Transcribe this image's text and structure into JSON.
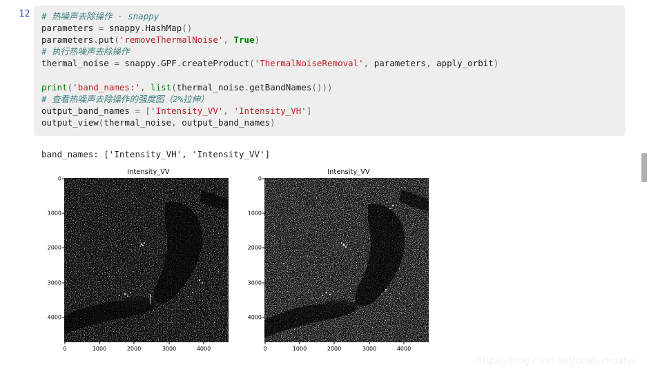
{
  "notebook": {
    "cell_prompt": "12",
    "code_lines": [
      [
        {
          "t": "cm",
          "v": "# 热噪声去除操作 - snappy"
        }
      ],
      [
        {
          "t": "nm",
          "v": "parameters "
        },
        {
          "t": "pn",
          "v": "= "
        },
        {
          "t": "nm",
          "v": "snappy"
        },
        {
          "t": "pn",
          "v": "."
        },
        {
          "t": "nm",
          "v": "HashMap"
        },
        {
          "t": "pn",
          "v": "()"
        }
      ],
      [
        {
          "t": "nm",
          "v": "parameters"
        },
        {
          "t": "pn",
          "v": "."
        },
        {
          "t": "nm",
          "v": "put"
        },
        {
          "t": "pn",
          "v": "("
        },
        {
          "t": "st",
          "v": "'removeThermalNoise'"
        },
        {
          "t": "pn",
          "v": ", "
        },
        {
          "t": "kw",
          "v": "True"
        },
        {
          "t": "pn",
          "v": ")"
        }
      ],
      [
        {
          "t": "cm",
          "v": "# 执行热噪声去除操作"
        }
      ],
      [
        {
          "t": "nm",
          "v": "thermal_noise "
        },
        {
          "t": "pn",
          "v": "= "
        },
        {
          "t": "nm",
          "v": "snappy"
        },
        {
          "t": "pn",
          "v": "."
        },
        {
          "t": "nm",
          "v": "GPF"
        },
        {
          "t": "pn",
          "v": "."
        },
        {
          "t": "nm",
          "v": "createProduct"
        },
        {
          "t": "pn",
          "v": "("
        },
        {
          "t": "st",
          "v": "'ThermalNoiseRemoval'"
        },
        {
          "t": "pn",
          "v": ", "
        },
        {
          "t": "nm",
          "v": "parameters"
        },
        {
          "t": "pn",
          "v": ", "
        },
        {
          "t": "nm",
          "v": "apply_orbit"
        },
        {
          "t": "pn",
          "v": ")"
        }
      ],
      [
        {
          "t": "nm",
          "v": ""
        }
      ],
      [
        {
          "t": "bi",
          "v": "print"
        },
        {
          "t": "pn",
          "v": "("
        },
        {
          "t": "st",
          "v": "'band_names:'"
        },
        {
          "t": "pn",
          "v": ", "
        },
        {
          "t": "bi",
          "v": "list"
        },
        {
          "t": "pn",
          "v": "("
        },
        {
          "t": "nm",
          "v": "thermal_noise"
        },
        {
          "t": "pn",
          "v": "."
        },
        {
          "t": "nm",
          "v": "getBandNames"
        },
        {
          "t": "pn",
          "v": "()))"
        }
      ],
      [
        {
          "t": "cm",
          "v": "# 查看热噪声去除操作的强度图（2%拉伸）"
        }
      ],
      [
        {
          "t": "nm",
          "v": "output_band_names "
        },
        {
          "t": "pn",
          "v": "= ["
        },
        {
          "t": "st",
          "v": "'Intensity_VV'"
        },
        {
          "t": "pn",
          "v": ", "
        },
        {
          "t": "st",
          "v": "'Intensity_VH'"
        },
        {
          "t": "pn",
          "v": "]"
        }
      ],
      [
        {
          "t": "nm",
          "v": "output_view"
        },
        {
          "t": "pn",
          "v": "("
        },
        {
          "t": "nm",
          "v": "thermal_noise"
        },
        {
          "t": "pn",
          "v": ", "
        },
        {
          "t": "nm",
          "v": "output_band_names"
        },
        {
          "t": "pn",
          "v": ")"
        }
      ]
    ],
    "stdout": "band_names: ['Intensity_VH', 'Intensity_VV']"
  },
  "chart_data": [
    {
      "type": "heatmap",
      "title": "Intensity_VV",
      "xlabel": "",
      "ylabel": "",
      "xticks": [
        "0",
        "1000",
        "2000",
        "3000",
        "4000"
      ],
      "yticks": [
        "0",
        "1000",
        "2000",
        "3000",
        "4000"
      ],
      "xlim": [
        0,
        4700
      ],
      "ylim": [
        4700,
        0
      ],
      "grid": false,
      "legend": "none",
      "colormap": "gray",
      "description": "Sentinel-1 SAR VV intensity image, 2% linear stretch, dark river/lake body crossing diagonally"
    },
    {
      "type": "heatmap",
      "title": "Intensity_VV",
      "xlabel": "",
      "ylabel": "",
      "xticks": [
        "0",
        "1000",
        "2000",
        "3000",
        "4000"
      ],
      "yticks": [
        "0",
        "1000",
        "2000",
        "3000",
        "4000"
      ],
      "xlim": [
        0,
        4700
      ],
      "ylim": [
        4700,
        0
      ],
      "grid": false,
      "legend": "none",
      "colormap": "gray",
      "description": "Sentinel-1 SAR VV intensity image after thermal noise removal, 2% linear stretch"
    }
  ],
  "watermark": {
    "text": "https://blog.csdn.net/lidahuilidahui"
  },
  "colors": {
    "prompt": "#2a53b8",
    "code_background": "#eeeeee",
    "comment": "#408080",
    "string": "#ba2121",
    "keyword": "#008000",
    "page_background": "#ffffff",
    "scrollbar_thumb": "#b0b0b0"
  }
}
